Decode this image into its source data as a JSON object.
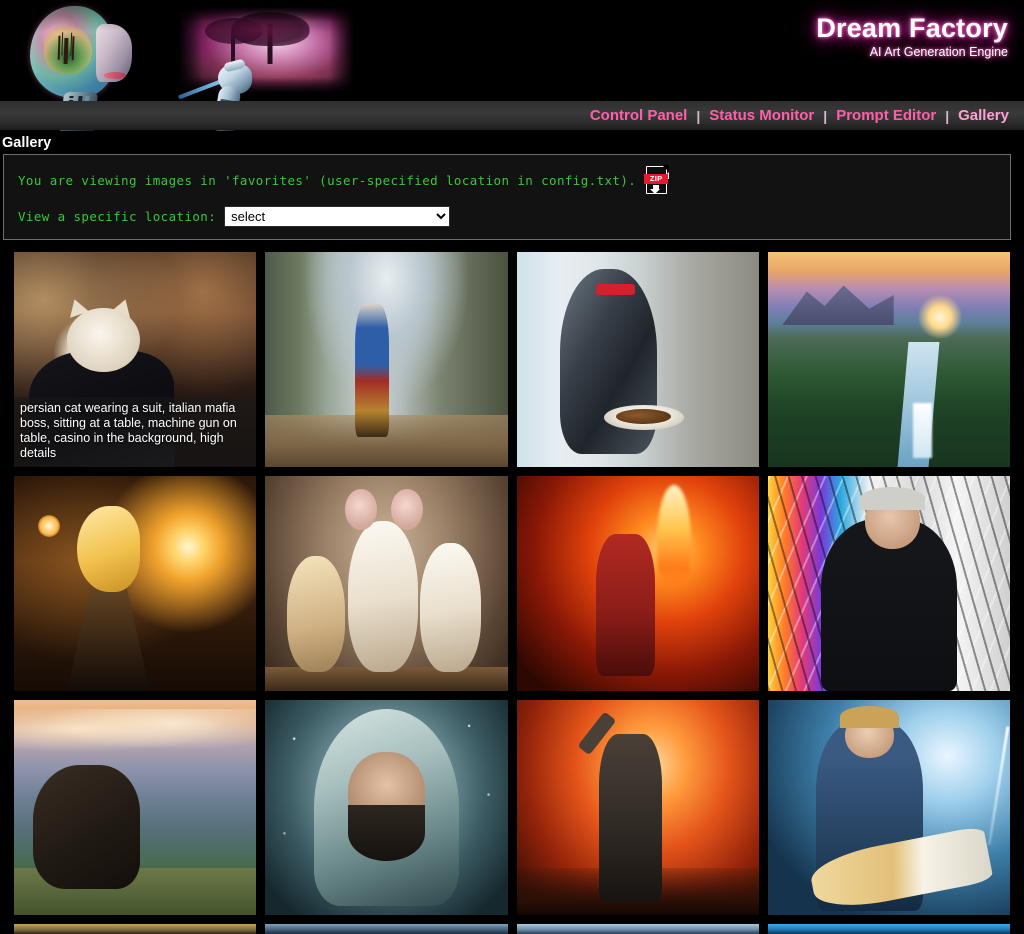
{
  "header": {
    "brand_title": "Dream Factory",
    "brand_subtitle": "AI Art Generation Engine",
    "logo_head_icon": "cyborg-head-icon",
    "logo_canvas_icon": "painted-tree-canvas-icon",
    "logo_hand_icon": "robot-hand-brush-icon",
    "glow_color": "#ff5fa8"
  },
  "nav": {
    "items": [
      {
        "label": "Control Panel",
        "active": false
      },
      {
        "label": "Status Monitor",
        "active": false
      },
      {
        "label": "Prompt Editor",
        "active": false
      },
      {
        "label": "Gallery",
        "active": true
      }
    ],
    "separator": "|",
    "link_color": "#ff5fa8",
    "active_color": "#ff9fd4"
  },
  "page": {
    "title": "Gallery"
  },
  "info": {
    "status_text": "You are viewing images in 'favorites' (user-specified location in config.txt).",
    "zip_icon": "zip-download-icon",
    "zip_label": "ZIP",
    "location_label": "View a specific location:",
    "location_value": "select",
    "location_options": [
      "select"
    ],
    "text_color": "#37c837"
  },
  "gallery": {
    "tiles": [
      {
        "name": "persian-cat-mafia-boss",
        "art_class": "art-cat",
        "caption": "persian cat wearing a suit, italian mafia boss, sitting at a table, machine gun on table, casino in the background, high details",
        "has_caption": true
      },
      {
        "name": "bearded-warrior-canyon",
        "art_class": "art-warrior",
        "caption": "",
        "has_caption": false
      },
      {
        "name": "robot-chef-kitchen",
        "art_class": "art-robot",
        "caption": "",
        "has_caption": false
      },
      {
        "name": "canyon-waterfall-sunset",
        "art_class": "art-canyon",
        "caption": "",
        "has_caption": false
      },
      {
        "name": "golden-sorceress-light",
        "art_class": "art-sorceress",
        "caption": "",
        "has_caption": false
      },
      {
        "name": "three-standing-mice",
        "art_class": "art-mice",
        "caption": "",
        "has_caption": false
      },
      {
        "name": "fire-dancer-woman",
        "art_class": "art-fire",
        "caption": "",
        "has_caption": false
      },
      {
        "name": "painter-artist-studio",
        "art_class": "art-painter",
        "caption": "",
        "has_caption": false
      },
      {
        "name": "black-beast-mountains",
        "art_class": "art-beast",
        "caption": "",
        "has_caption": false
      },
      {
        "name": "hooded-knight-portrait",
        "art_class": "art-knight",
        "caption": "",
        "has_caption": false
      },
      {
        "name": "robed-prophet-fire",
        "art_class": "art-prophet",
        "caption": "",
        "has_caption": false
      },
      {
        "name": "guitarist-lightning",
        "art_class": "art-guitar",
        "caption": "",
        "has_caption": false
      }
    ],
    "partial_row": [
      {
        "name": "partial-tile-1",
        "art_class": "art-cut-a"
      },
      {
        "name": "partial-tile-2",
        "art_class": "art-cut-b"
      },
      {
        "name": "partial-tile-3",
        "art_class": "art-cut-c"
      },
      {
        "name": "partial-tile-4",
        "art_class": "art-cut-d"
      }
    ]
  }
}
